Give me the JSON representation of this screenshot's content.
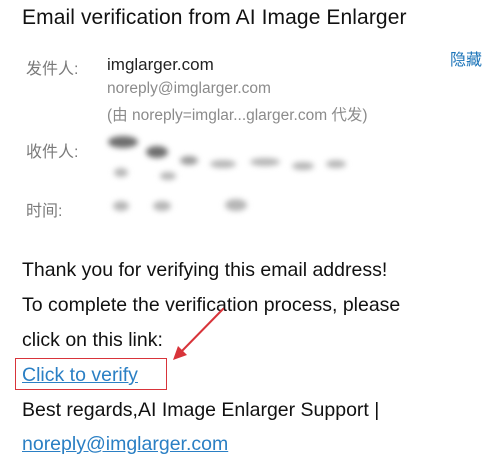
{
  "email": {
    "subject": "Email verification from AI Image Enlarger",
    "hide_label": "隐藏",
    "sender_label": "发件人:",
    "sender_name": "imglarger.com",
    "sender_email": "noreply@imglarger.com",
    "sender_via": "(由 noreply=imglar...glarger.com 代发)",
    "recipient_label": "收件人:",
    "time_label": "时间:"
  },
  "body": {
    "line1": "Thank you for verifying this email address!",
    "line2": "To complete the verification process, please",
    "line3": "click on this link:",
    "verify_link": "Click to verify",
    "line4": "Best regards,AI Image Enlarger Support |",
    "support_email": "noreply@imglarger.com"
  },
  "colors": {
    "link": "#2a7fc4",
    "annotation": "#d8343a",
    "label": "#7a7a7a"
  }
}
